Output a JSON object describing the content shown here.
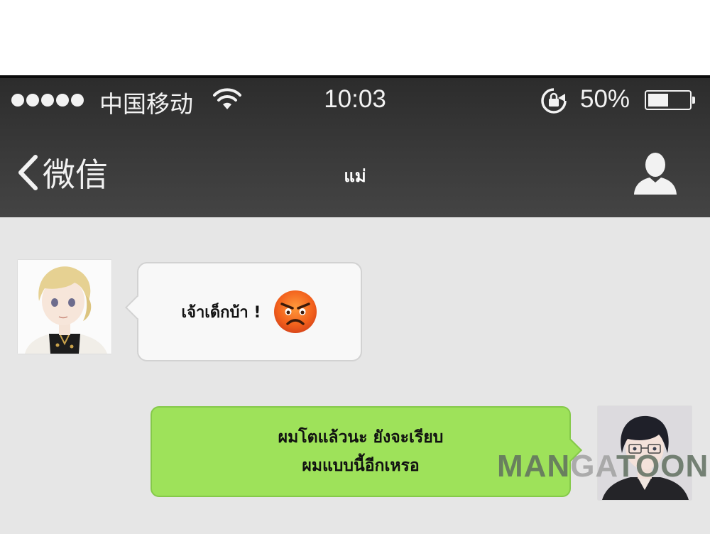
{
  "status_bar": {
    "carrier": "中国移动",
    "time": "10:03",
    "battery_percent": "50%",
    "battery_level": 0.5,
    "signal_bars": 5
  },
  "nav": {
    "back_label": "微信",
    "title": "แม่"
  },
  "messages": [
    {
      "sender": "mom",
      "text": "เจ้าเด็กบ้า !",
      "emoji": "angry-face"
    },
    {
      "sender": "me",
      "lines": [
        "ผมโตแล้วนะ ยังจะเรียบ",
        "ผมแบบนี้อีกเหรอ"
      ]
    }
  ],
  "watermark": {
    "part1": "MAN",
    "part2": "GA",
    "part3": "TOON"
  },
  "colors": {
    "header": "#333333",
    "chat_bg": "#e6e6e6",
    "incoming_bubble": "#f8f8f8",
    "outgoing_bubble": "#9ee25a"
  }
}
